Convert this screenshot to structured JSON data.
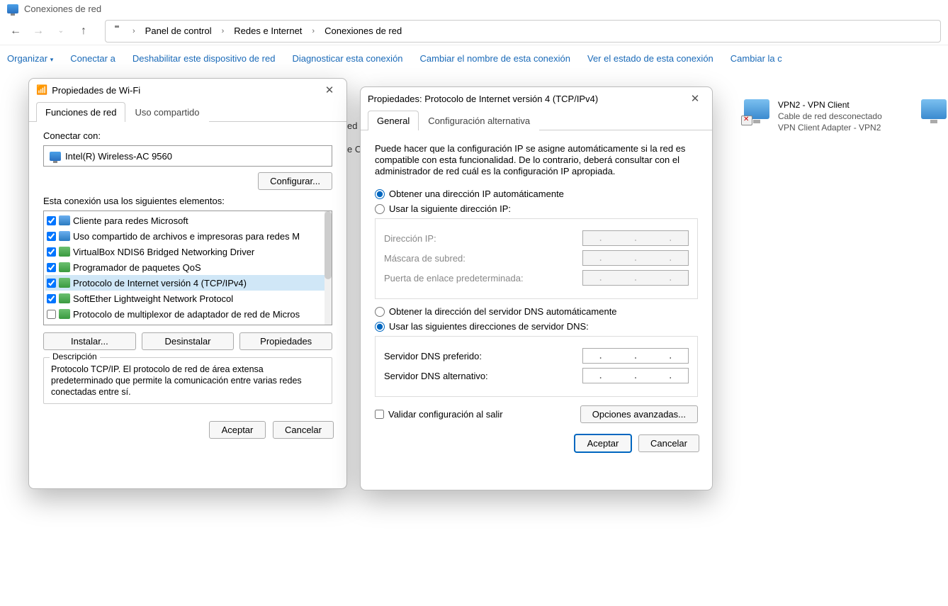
{
  "window_title": "Conexiones de red",
  "breadcrumb": [
    "Panel de control",
    "Redes e Internet",
    "Conexiones de red"
  ],
  "toolbar": {
    "organize": "Organizar",
    "connect_to": "Conectar a",
    "disable": "Deshabilitar este dispositivo de red",
    "diagnose": "Diagnosticar esta conexión",
    "rename": "Cambiar el nombre de esta conexión",
    "view_status": "Ver el estado de esta conexión",
    "change": "Cambiar la c"
  },
  "connection_peek": {
    "name_fragment": "ed C",
    "line2_fragment": "e C"
  },
  "vpn_item": {
    "name": "VPN2 - VPN Client",
    "status": "Cable de red desconectado",
    "adapter": "VPN Client Adapter - VPN2"
  },
  "wifi_dialog": {
    "title": "Propiedades de Wi-Fi",
    "tabs": {
      "functions": "Funciones de red",
      "sharing": "Uso compartido"
    },
    "connect_with": "Conectar con:",
    "adapter": "Intel(R) Wireless-AC 9560",
    "configure": "Configurar...",
    "uses_elements": "Esta conexión usa los siguientes elementos:",
    "components": [
      {
        "checked": true,
        "label": "Cliente para redes Microsoft"
      },
      {
        "checked": true,
        "label": "Uso compartido de archivos e impresoras para redes M"
      },
      {
        "checked": true,
        "label": "VirtualBox NDIS6 Bridged Networking Driver"
      },
      {
        "checked": true,
        "label": "Programador de paquetes QoS"
      },
      {
        "checked": true,
        "label": "Protocolo de Internet versión 4 (TCP/IPv4)",
        "selected": true
      },
      {
        "checked": true,
        "label": "SoftEther Lightweight Network Protocol"
      },
      {
        "checked": false,
        "label": "Protocolo de multiplexor de adaptador de red de Micros"
      }
    ],
    "install": "Instalar...",
    "uninstall": "Desinstalar",
    "properties": "Propiedades",
    "description_label": "Descripción",
    "description_text": "Protocolo TCP/IP. El protocolo de red de área extensa predeterminado que permite la comunicación entre varias redes conectadas entre sí.",
    "accept": "Aceptar",
    "cancel": "Cancelar"
  },
  "ipv4_dialog": {
    "title": "Propiedades: Protocolo de Internet versión 4 (TCP/IPv4)",
    "tabs": {
      "general": "General",
      "alt": "Configuración alternativa"
    },
    "desc": "Puede hacer que la configuración IP se asigne automáticamente si la red es compatible con esta funcionalidad. De lo contrario, deberá consultar con el administrador de red cuál es la configuración IP apropiada.",
    "ip_auto": "Obtener una dirección IP automáticamente",
    "ip_manual": "Usar la siguiente dirección IP:",
    "ip_addr": "Dirección IP:",
    "subnet": "Máscara de subred:",
    "gateway": "Puerta de enlace predeterminada:",
    "dns_auto": "Obtener la dirección del servidor DNS automáticamente",
    "dns_manual": "Usar las siguientes direcciones de servidor DNS:",
    "dns_pref": "Servidor DNS preferido:",
    "dns_alt": "Servidor DNS alternativo:",
    "validate": "Validar configuración al salir",
    "advanced": "Opciones avanzadas...",
    "accept": "Aceptar",
    "cancel": "Cancelar",
    "ip_mode_selected": "auto",
    "dns_mode_selected": "manual"
  }
}
